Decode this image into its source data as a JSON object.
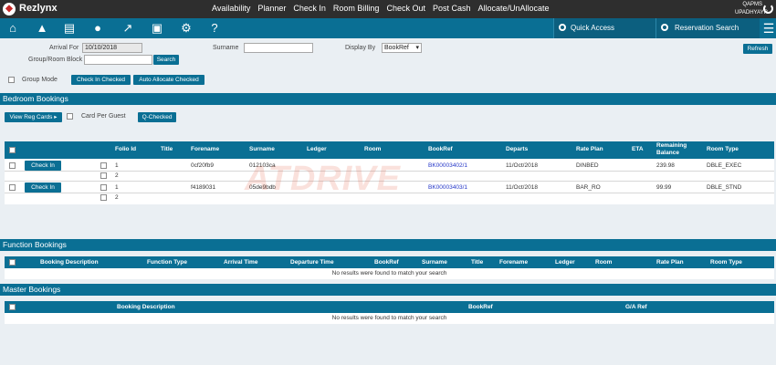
{
  "brand": "Rezlynx",
  "top_menu": [
    "Availability",
    "Planner",
    "Check In",
    "Room Billing",
    "Check Out",
    "Post Cash",
    "Allocate/UnAllocate"
  ],
  "user": {
    "line1": "QAPMS",
    "line2": "UPADHYAYR"
  },
  "icon_bar": {
    "icons": [
      "home-icon",
      "bell-icon",
      "id-card-icon",
      "group-icon",
      "chart-icon",
      "bank-icon",
      "settings-icon",
      "help-icon"
    ],
    "quick_access": "Quick Access",
    "reservation_search": "Reservation Search"
  },
  "filters": {
    "arrival_for_label": "Arrival For",
    "arrival_for_value": "10/10/2018",
    "surname_label": "Surname",
    "surname_value": "",
    "display_by_label": "Display By",
    "display_by_value": "BookRef",
    "group_ref_label": "Group/Room Block Ref",
    "group_ref_value": "",
    "search_label": "Search",
    "refresh_label": "Refresh",
    "group_mode_label": "Group Mode",
    "check_in_checked_label": "Check In Checked",
    "auto_allocate_label": "Auto Allocate Checked"
  },
  "bedroom": {
    "title": "Bedroom Bookings",
    "view_reg_cards": "View Reg Cards",
    "card_per_guest": "Card Per Guest",
    "q_checked": "Q-Checked",
    "columns": [
      "Folio Id",
      "Title",
      "Forename",
      "Surname",
      "Ledger",
      "Room",
      "BookRef",
      "Departs",
      "Rate Plan",
      "ETA",
      "Remaining Balance",
      "Room Type"
    ],
    "rows": [
      {
        "action": "Check In",
        "folios": [
          "1",
          "2"
        ],
        "title": "",
        "forename": "0cf20fb9",
        "surname": "012103ca",
        "ledger": "",
        "room": "",
        "bookref": "BK00003402/1",
        "departs": "11/Oct/2018",
        "rate_plan": "DINBED",
        "eta": "",
        "balance": "239.98",
        "room_type": "DBLE_EXEC"
      },
      {
        "action": "Check In",
        "folios": [
          "1",
          "2"
        ],
        "title": "",
        "forename": "f4189031",
        "surname": "05de9bdb",
        "ledger": "",
        "room": "",
        "bookref": "BK00003403/1",
        "departs": "11/Oct/2018",
        "rate_plan": "BAR_RO",
        "eta": "",
        "balance": "99.99",
        "room_type": "DBLE_STND"
      }
    ]
  },
  "function": {
    "title": "Function Bookings",
    "columns": [
      "Booking Description",
      "Function Type",
      "Arrival Time",
      "Departure Time",
      "BookRef",
      "Surname",
      "Title",
      "Forename",
      "Ledger",
      "Room",
      "Rate Plan",
      "Room Type"
    ],
    "empty": "No results were found to match your search"
  },
  "master": {
    "title": "Master Bookings",
    "columns": [
      "Booking Description",
      "BookRef",
      "G/A Ref"
    ],
    "empty": "No results were found to match your search"
  },
  "watermark": "ATDRIVE",
  "colors": {
    "primary": "#0a6f94",
    "topbar": "#2e2e2e",
    "link": "#2436c8",
    "background": "#eaeff3"
  }
}
